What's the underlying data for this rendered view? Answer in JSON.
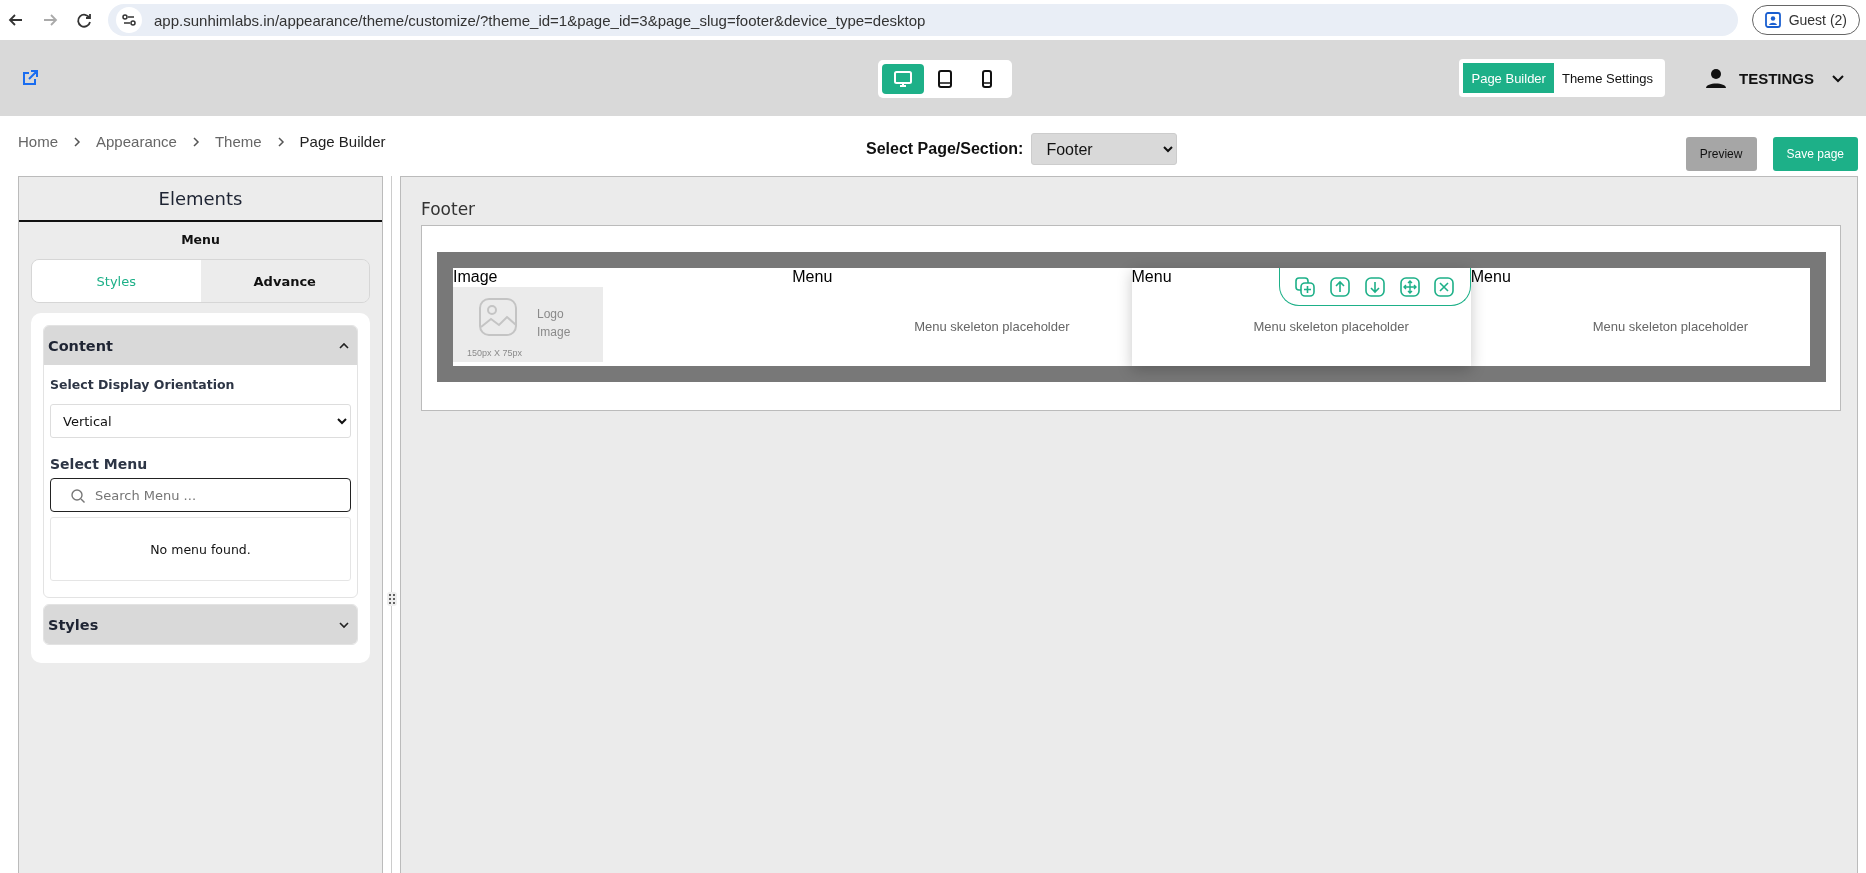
{
  "browser": {
    "url": "app.sunhimlabs.in/appearance/theme/customize/?theme_id=1&page_id=3&page_slug=footer&device_type=desktop",
    "profile": "Guest (2)"
  },
  "header": {
    "devices": [
      {
        "kind": "desktop",
        "selected": true
      },
      {
        "kind": "tablet",
        "selected": false
      },
      {
        "kind": "mobile",
        "selected": false
      }
    ],
    "mode_tabs": [
      {
        "label": "Page Builder",
        "selected": true
      },
      {
        "label": "Theme Settings",
        "selected": false
      }
    ],
    "user": "TESTINGS"
  },
  "breadcrumb": [
    "Home",
    "Appearance",
    "Theme",
    "Page Builder"
  ],
  "page_select": {
    "label": "Select Page/Section:",
    "value": "Footer"
  },
  "actions": {
    "preview": "Preview",
    "save": "Save page"
  },
  "sidebar": {
    "title": "Elements",
    "element": "Menu",
    "tabs": [
      {
        "label": "Styles",
        "selected": true
      },
      {
        "label": "Advance",
        "selected": false
      }
    ],
    "sections": [
      {
        "title": "Content",
        "expanded": true,
        "orientation_label": "Select Display Orientation",
        "orientation_value": "Vertical",
        "menu_label": "Select Menu",
        "search_placeholder": "Search Menu ...",
        "empty_text": "No menu found."
      },
      {
        "title": "Styles",
        "expanded": false
      }
    ]
  },
  "canvas": {
    "title": "Footer",
    "columns": [
      {
        "kind": "image",
        "label": "Image",
        "selected": false,
        "image_caption": "Logo Image",
        "image_size": "150px X 75px"
      },
      {
        "kind": "menu",
        "label": "Menu",
        "selected": false,
        "placeholder": "Menu skeleton placeholder"
      },
      {
        "kind": "menu",
        "label": "Menu",
        "selected": true,
        "placeholder": "Menu skeleton placeholder"
      },
      {
        "kind": "menu",
        "label": "Menu",
        "selected": false,
        "placeholder": "Menu skeleton placeholder"
      }
    ]
  }
}
